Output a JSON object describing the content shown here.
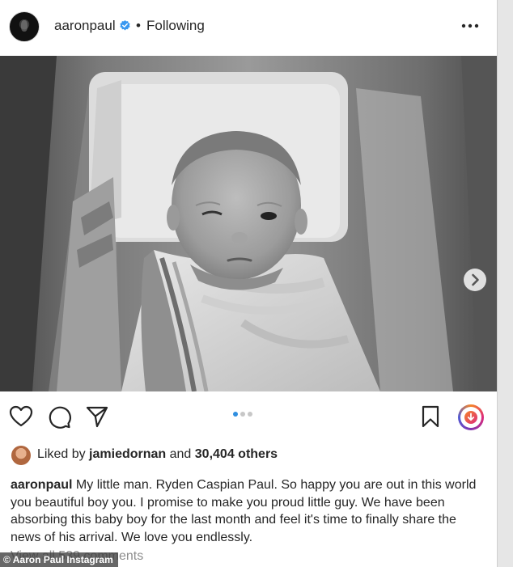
{
  "header": {
    "username": "aaronpaul",
    "separator": "•",
    "follow_state": "Following",
    "verified_icon": "verified-badge-icon",
    "more_icon": "more-options-icon"
  },
  "photo": {
    "description_icon": "photo",
    "carousel": {
      "total": 3,
      "active_index": 0
    },
    "next_icon": "chevron-right-icon"
  },
  "actions": {
    "like_icon": "heart-icon",
    "comment_icon": "comment-icon",
    "share_icon": "send-icon",
    "save_icon": "bookmark-icon",
    "download_icon": "download-icon"
  },
  "likes": {
    "prefix": "Liked by ",
    "user": "jamiedornan",
    "middle": " and ",
    "count": "30,404 others"
  },
  "caption": {
    "user": "aaronpaul",
    "text": " My little man. Ryden Caspian Paul. So happy you are out in this world you beautiful boy you. I promise to make you proud little guy. We have been absorbing this baby boy for the last month and feel it's time to finally share the news of his arrival. We love you endlessly."
  },
  "comments": {
    "link": "View all 539 comments"
  },
  "credit": {
    "text": "© Aaron Paul Instagram"
  },
  "colors": {
    "accent_blue": "#3897f0",
    "text": "#262626",
    "muted": "#8e8e8e"
  }
}
